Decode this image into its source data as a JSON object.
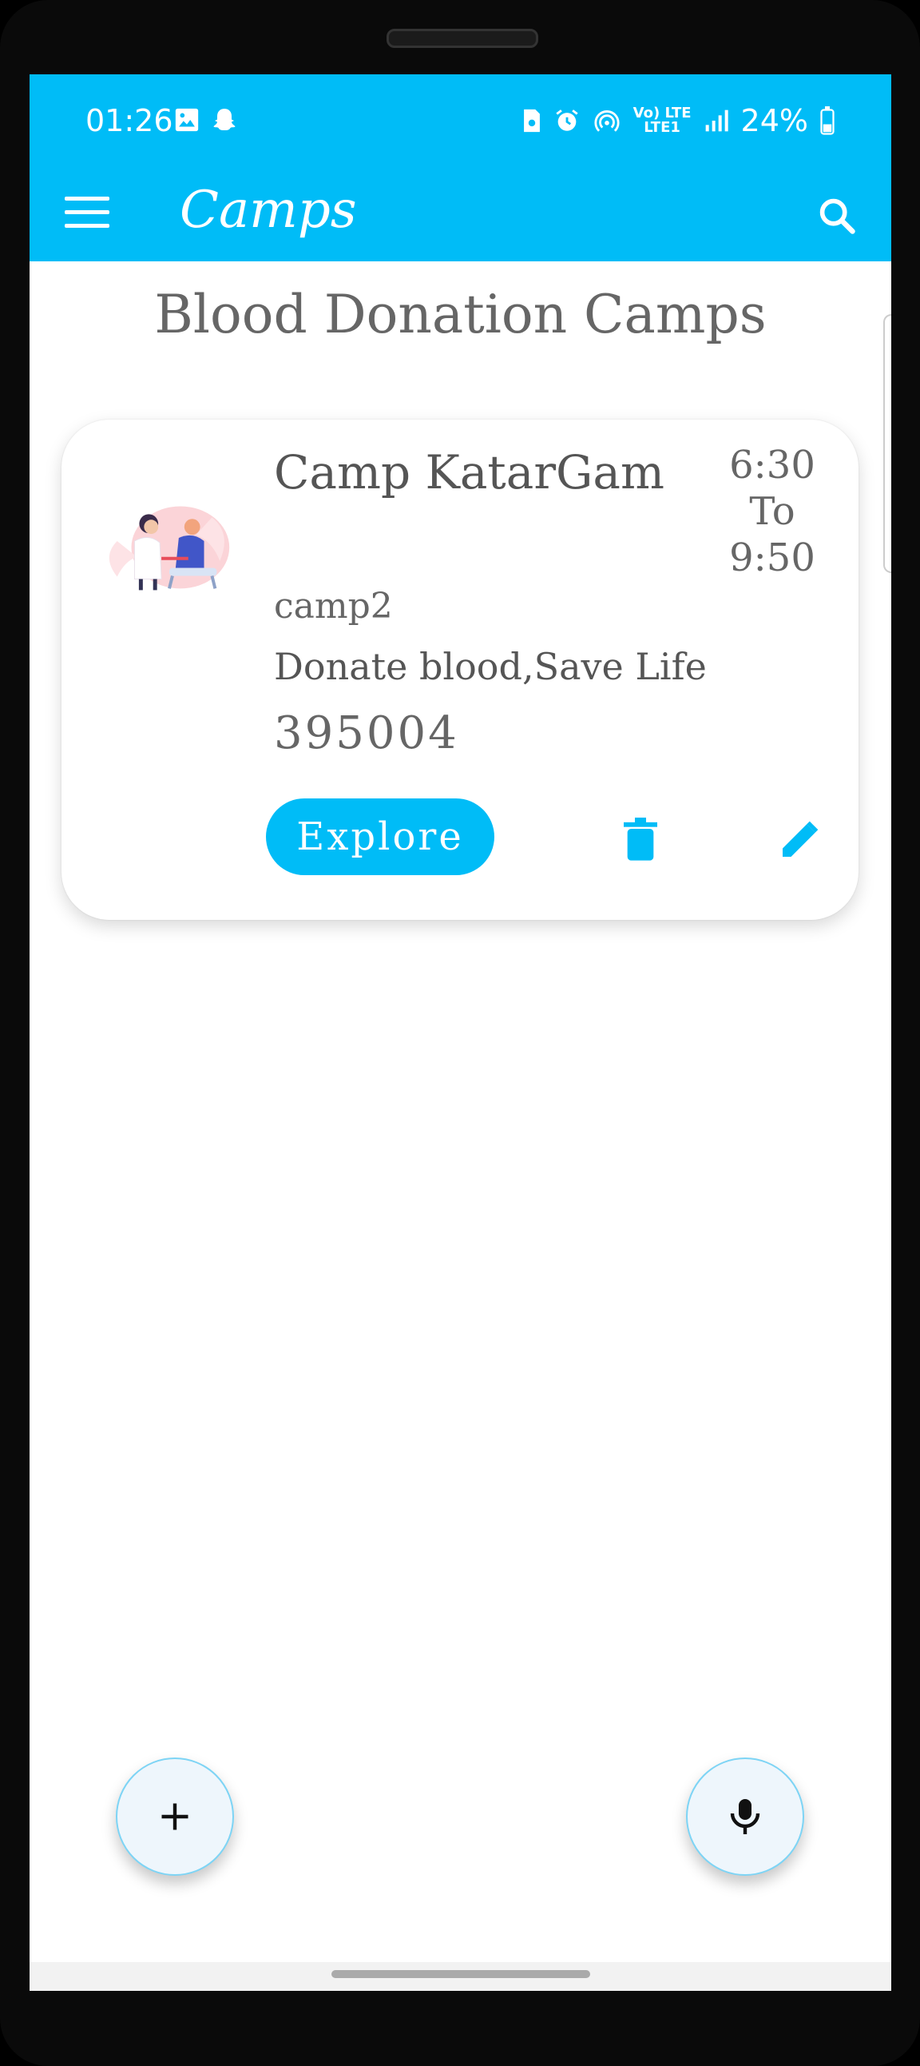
{
  "status_bar": {
    "time": "01:26",
    "battery": "24%",
    "network_top": "Vo) LTE",
    "network_bottom": "LTE1",
    "icons": [
      "gallery-icon",
      "snapchat-icon",
      "sim-icon",
      "alarm-icon",
      "hotspot-icon",
      "signal-icon",
      "battery-icon"
    ]
  },
  "app_bar": {
    "title": "Camps",
    "menu_icon": "menu-icon",
    "search_icon": "search-icon"
  },
  "page": {
    "heading": "Blood Donation Camps"
  },
  "camps": [
    {
      "name": "Camp KatarGam",
      "code": "camp2",
      "slogan": "Donate blood,Save Life",
      "pincode": "395004",
      "time_start": "6:30",
      "time_sep": "To",
      "time_end": "9:50",
      "explore_label": "Explore",
      "image": "blood-donation-illustration"
    }
  ],
  "fabs": {
    "add_icon": "plus-icon",
    "mic_icon": "mic-icon"
  },
  "colors": {
    "accent": "#00bcf7",
    "text": "#666666",
    "fab_bg": "#eef6fc"
  }
}
